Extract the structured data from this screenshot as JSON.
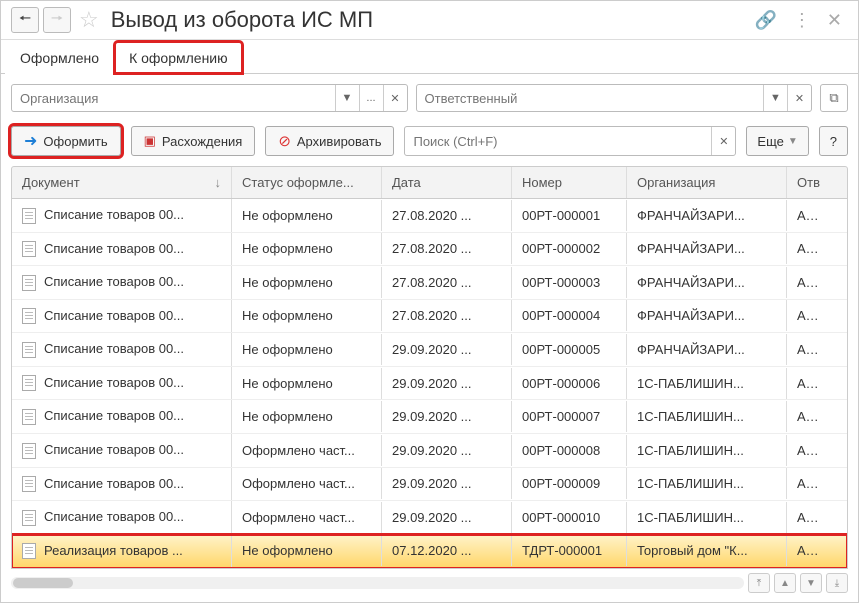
{
  "title": "Вывод из оборота ИС МП",
  "tabs": [
    {
      "label": "Оформлено"
    },
    {
      "label": "К оформлению"
    }
  ],
  "filters": {
    "org_placeholder": "Организация",
    "resp_placeholder": "Ответственный"
  },
  "toolbar": {
    "create": "Оформить",
    "diff": "Расхождения",
    "archive": "Архивировать",
    "search_placeholder": "Поиск (Ctrl+F)",
    "more": "Еще",
    "help": "?"
  },
  "columns": {
    "doc": "Документ",
    "status": "Статус оформле...",
    "date": "Дата",
    "num": "Номер",
    "org": "Организация",
    "resp": "Отв"
  },
  "rows": [
    {
      "doc": "Списание товаров 00...",
      "status": "Не оформлено",
      "date": "27.08.2020 ...",
      "num": "00РТ-000001",
      "org": "ФРАНЧАЙЗАРИ...",
      "resp": "Адм"
    },
    {
      "doc": "Списание товаров 00...",
      "status": "Не оформлено",
      "date": "27.08.2020 ...",
      "num": "00РТ-000002",
      "org": "ФРАНЧАЙЗАРИ...",
      "resp": "Адм"
    },
    {
      "doc": "Списание товаров 00...",
      "status": "Не оформлено",
      "date": "27.08.2020 ...",
      "num": "00РТ-000003",
      "org": "ФРАНЧАЙЗАРИ...",
      "resp": "Адм"
    },
    {
      "doc": "Списание товаров 00...",
      "status": "Не оформлено",
      "date": "27.08.2020 ...",
      "num": "00РТ-000004",
      "org": "ФРАНЧАЙЗАРИ...",
      "resp": "Адм"
    },
    {
      "doc": "Списание товаров 00...",
      "status": "Не оформлено",
      "date": "29.09.2020 ...",
      "num": "00РТ-000005",
      "org": "ФРАНЧАЙЗАРИ...",
      "resp": "Адм"
    },
    {
      "doc": "Списание товаров 00...",
      "status": "Не оформлено",
      "date": "29.09.2020 ...",
      "num": "00РТ-000006",
      "org": "1С-ПАБЛИШИН...",
      "resp": "Адм"
    },
    {
      "doc": "Списание товаров 00...",
      "status": "Не оформлено",
      "date": "29.09.2020 ...",
      "num": "00РТ-000007",
      "org": "1С-ПАБЛИШИН...",
      "resp": "Адм"
    },
    {
      "doc": "Списание товаров 00...",
      "status": "Оформлено част...",
      "date": "29.09.2020 ...",
      "num": "00РТ-000008",
      "org": "1С-ПАБЛИШИН...",
      "resp": "Адм"
    },
    {
      "doc": "Списание товаров 00...",
      "status": "Оформлено част...",
      "date": "29.09.2020 ...",
      "num": "00РТ-000009",
      "org": "1С-ПАБЛИШИН...",
      "resp": "Адм"
    },
    {
      "doc": "Списание товаров 00...",
      "status": "Оформлено част...",
      "date": "29.09.2020 ...",
      "num": "00РТ-000010",
      "org": "1С-ПАБЛИШИН...",
      "resp": "Адм"
    },
    {
      "doc": "Реализация товаров ...",
      "status": "Не оформлено",
      "date": "07.12.2020 ...",
      "num": "ТДРТ-000001",
      "org": "Торговый дом \"К...",
      "resp": "Адм",
      "highlight": true
    }
  ]
}
